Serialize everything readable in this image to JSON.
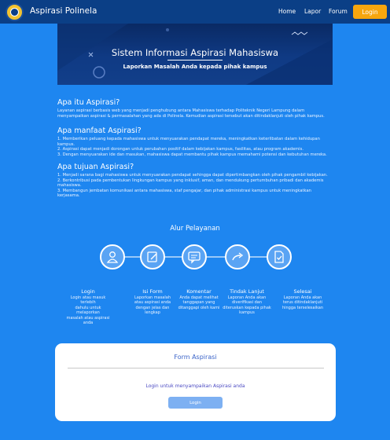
{
  "navbar": {
    "brand": "Aspirasi Polinela",
    "links": [
      "Home",
      "Lapor",
      "Forum"
    ],
    "login_button": "Login"
  },
  "banner": {
    "title": "Sistem Informasi Aspirasi Mahasiswa",
    "subtitle": "Laporkan Masalah Anda kepada pihak kampus"
  },
  "sections": [
    {
      "heading": "Apa itu Aspirasi?",
      "lines": [
        "Layanan aspirasi berbasis web yang menjadi penghubung antara Mahasiswa terhadap Politeknik Negeri Lampung dalam",
        "menyampaikan aspirasi & permasalahan yang ada di Polinela. Kemudian aspirasi tersebut akan ditindaklanjuti oleh pihak kampus."
      ]
    },
    {
      "heading": "Apa manfaat Aspirasi?",
      "lines": [
        "1. Memberikan peluang kepada mahasiswa untuk menyuarakan pendapat mereka, meningkatkan keterlibatan dalam kehidupan",
        "kampus.",
        "2. Aspirasi dapat menjadi dorongan untuk perubahan positif dalam kebijakan kampus, fasilitas, atau program akademis.",
        "3. Dengan menyuarakan ide dan masukan, mahasiswa dapat membantu pihak kampus memahami potensi dan kebutuhan mereka."
      ]
    },
    {
      "heading": "Apa tujuan Aspirasi?",
      "lines": [
        "1. Menjadi sarana bagi mahasiswa untuk menyuarakan pendapat sehingga dapat dipertimbangkan oleh pihak pengambil kebijakan.",
        "2. Berkontribusi pada pembentukan lingkungan kampus yang inklusif, aman, dan mendukung pertumbuhan pribadi dan akademis",
        "mahasiswa.",
        "3. Membangun jembatan komunikasi antara mahasiswa, staf pengajar, dan pihak administrasi kampus untuk meningkatkan",
        "kerjasama."
      ]
    }
  ],
  "alur": {
    "title": "Alur Pelayanan",
    "steps": [
      {
        "icon": "user-icon",
        "title": "Login",
        "desc": [
          "Login atau masuk terlebih",
          "dahulu untuk melaporkan",
          "masalah atau aspirasi anda"
        ]
      },
      {
        "icon": "edit-form-icon",
        "title": "Isi Form",
        "desc": [
          "Laporkan masalah",
          "atau aspirasi anda",
          "dengan jelas dan",
          "lengkap"
        ]
      },
      {
        "icon": "comment-icon",
        "title": "Komentar",
        "desc": [
          "Anda dapat melihat",
          "tanggapan yang",
          "ditanggapi oleh kami"
        ]
      },
      {
        "icon": "share-arrow-icon",
        "title": "Tindak Lanjut",
        "desc": [
          "Laporan Anda akan",
          "diverifikasi dan",
          "diteruskan kepada pihak",
          "kampus"
        ]
      },
      {
        "icon": "document-check-icon",
        "title": "Selesai",
        "desc": [
          "Laporan Anda akan",
          "terus ditindaklanjuti",
          "hingga terselesaikan"
        ]
      }
    ]
  },
  "form_card": {
    "title": "Form Aspirasi",
    "prompt": "Login untuk menyampaikan Aspirasi anda",
    "button": "Login"
  },
  "colors": {
    "page_bg": "#1e86f0",
    "navbar_bg": "#0b3f86",
    "accent": "#f7a60e",
    "banner_bg": "#0f3a84",
    "card_title": "#3a63c8",
    "card_button": "#7db0f2"
  }
}
